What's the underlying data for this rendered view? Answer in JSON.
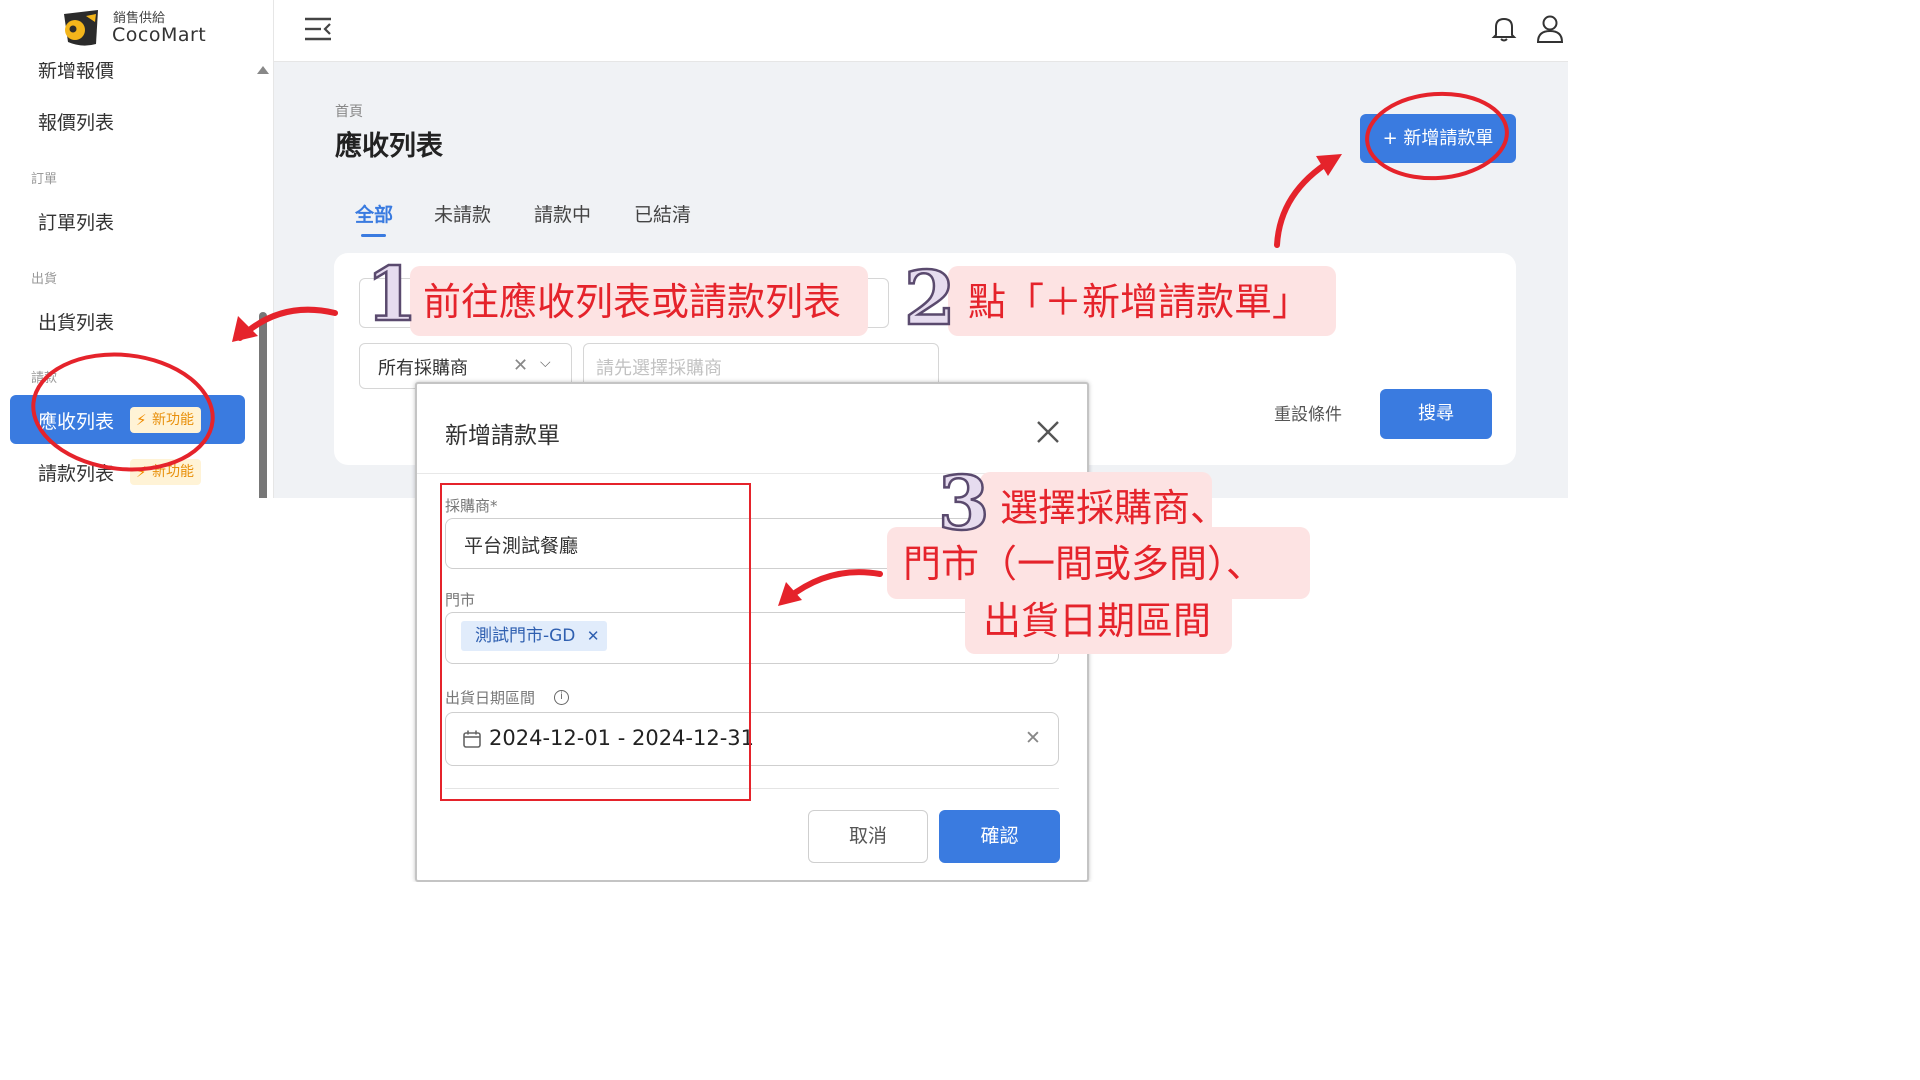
{
  "brand": {
    "subtitle": "銷售供給",
    "name": "CocoMart"
  },
  "sidebar": {
    "items": [
      {
        "label": "新增報價"
      },
      {
        "label": "報價列表"
      },
      {
        "group": "訂單"
      },
      {
        "label": "訂單列表"
      },
      {
        "group": "出貨"
      },
      {
        "label": "出貨列表"
      },
      {
        "group": "請款"
      },
      {
        "label": "應收列表",
        "badge": "新功能",
        "active": true
      },
      {
        "label": "請款列表",
        "badge": "新功能"
      }
    ]
  },
  "header": {
    "breadcrumb": "首頁",
    "title": "應收列表",
    "add_button": "+ 新增請款單"
  },
  "tabs": [
    "全部",
    "未請款",
    "請款中",
    "已結清"
  ],
  "filters": {
    "buyer_select": "所有採購商",
    "store_placeholder": "請先選擇採購商",
    "reset": "重設條件",
    "search": "搜尋"
  },
  "modal": {
    "title": "新增請款單",
    "buyer_label": "採購商*",
    "buyer_value": "平台測試餐廳",
    "store_label": "門市",
    "store_tag": "測試門市-GD",
    "date_label": "出貨日期區間",
    "date_value": "2024-12-01 - 2024-12-31",
    "cancel": "取消",
    "confirm": "確認"
  },
  "annotations": {
    "step1": {
      "number": "1",
      "text": "前往應收列表或請款列表"
    },
    "step2": {
      "number": "2",
      "text": "點「＋新增請款單」"
    },
    "step3": {
      "number": "3",
      "lines": [
        "選擇採購商、",
        "門市（一間或多間）、",
        "出貨日期區間"
      ]
    }
  },
  "colors": {
    "primary": "#3a7be0",
    "annotation_red": "#e5232b",
    "callout_bg": "#fde3e3",
    "badge_text": "#e8900c"
  }
}
